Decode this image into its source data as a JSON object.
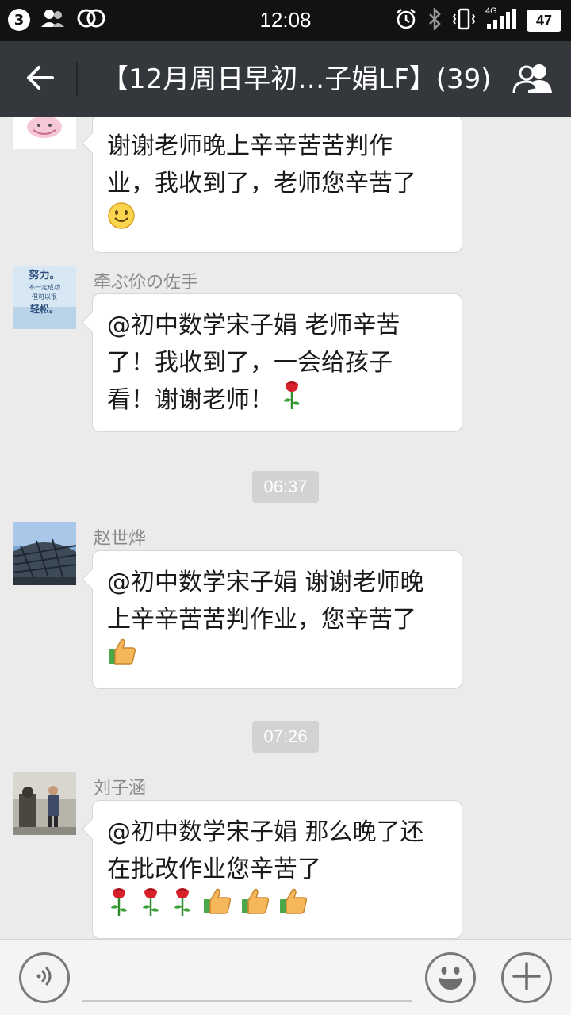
{
  "status_bar": {
    "notification_count": "3",
    "time": "12:08",
    "network_type": "4G",
    "battery": "47",
    "icons": [
      "contacts-icon",
      "infinity-icon",
      "alarm-icon",
      "bluetooth-icon",
      "vibrate-icon",
      "signal-icon"
    ]
  },
  "header": {
    "title": "【12月周日早初…子娟LF】(39)",
    "back_icon": "arrow-left-icon",
    "group_icon": "group-members-icon"
  },
  "messages": [
    {
      "sender": "",
      "avatar": "cartoon-avatar",
      "lines": [
        "谢谢老师晚上辛辛苦苦判作",
        "业，我收到了，老师您辛苦了"
      ],
      "emoji": [
        "smile-emoji"
      ]
    },
    {
      "sender": "牵ぶ伱の佐手",
      "avatar": "text-card-avatar",
      "avatar_text": [
        "努力。",
        "不一定成功",
        "但可以很",
        "轻松。"
      ],
      "lines": [
        "@初中数学宋子娟 老师辛苦",
        "了！我收到了，一会给孩子",
        "看！谢谢老师！"
      ],
      "emoji": [
        "rose-emoji"
      ]
    },
    {
      "sender": "赵世烨",
      "avatar": "stadium-avatar",
      "lines": [
        "@初中数学宋子娟 谢谢老师晚",
        "上辛辛苦苦判作业，您辛苦了"
      ],
      "emoji": [
        "thumbs-up-emoji"
      ]
    },
    {
      "sender": "刘子涵",
      "avatar": "person-photo-avatar",
      "lines": [
        "@初中数学宋子娟 那么晚了还",
        "在批改作业您辛苦了"
      ],
      "emoji": [
        "rose-emoji",
        "rose-emoji",
        "rose-emoji",
        "thumbs-up-emoji",
        "thumbs-up-emoji",
        "thumbs-up-emoji"
      ]
    }
  ],
  "timestamps": [
    "06:37",
    "07:26"
  ],
  "input_bar": {
    "placeholder": "",
    "voice_icon": "voice-icon",
    "emoji_icon": "emoji-icon",
    "plus_icon": "plus-icon"
  }
}
